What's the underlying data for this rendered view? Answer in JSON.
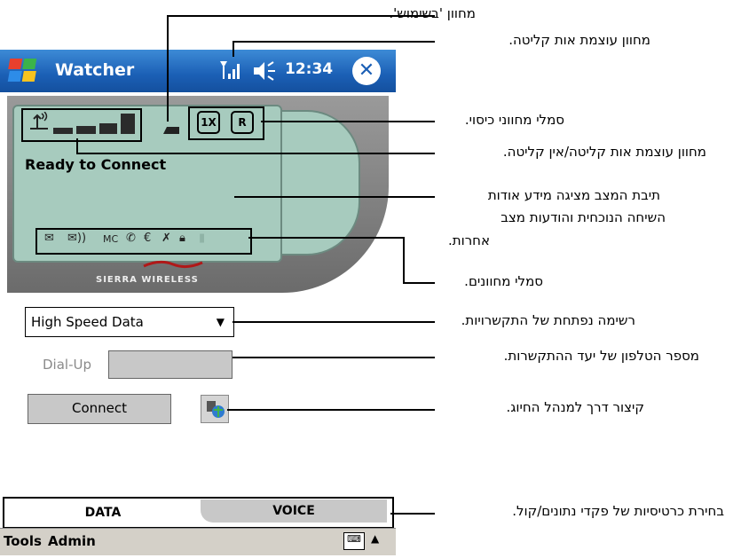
{
  "app": {
    "title": "Watcher",
    "time": "12:34",
    "status": "Ready to Connect",
    "brand": "SIERRA WIRELESS",
    "indicators": [
      "1X",
      "R"
    ],
    "notification_icons": [
      "mail-icon",
      "voicemail-icon",
      "missed-call-icon",
      "call-forward-icon",
      "euro-icon",
      "roaming-icon",
      "lock-icon",
      "signal-dim-icon"
    ]
  },
  "connection": {
    "type": "High Speed Data",
    "dialup_label": "Dial-Up",
    "dialup_value": "",
    "connect_label": "Connect"
  },
  "tabs": [
    "DATA",
    "VOICE"
  ],
  "menu": {
    "tools": "Tools",
    "admin": "Admin"
  },
  "callouts": {
    "in_use": "מחוון 'בשימוש'.",
    "signal_strength": "מחוון עוצמת אות קליטה.",
    "coverage": "סמלי מחווני כיסוי.",
    "signal_no_signal": "מחוון עוצמת אות קליטה/אין קליטה.",
    "status_line1": "תיבת המצב מציגה מידע אודות",
    "status_line2": "השיחה הנוכחית והודעות מצב",
    "status_line3": "אחרות.",
    "indicators": "סמלי מחוונים.",
    "dropdown": "רשימה נפתחת של התקשרויות.",
    "phone": "מספר הטלפון של יעד ההתקשרות.",
    "billing": "קיצור דרך למנהל החיוג.",
    "tabs": "בחירת כרטיסיות של פקדי נתונים/קול."
  }
}
